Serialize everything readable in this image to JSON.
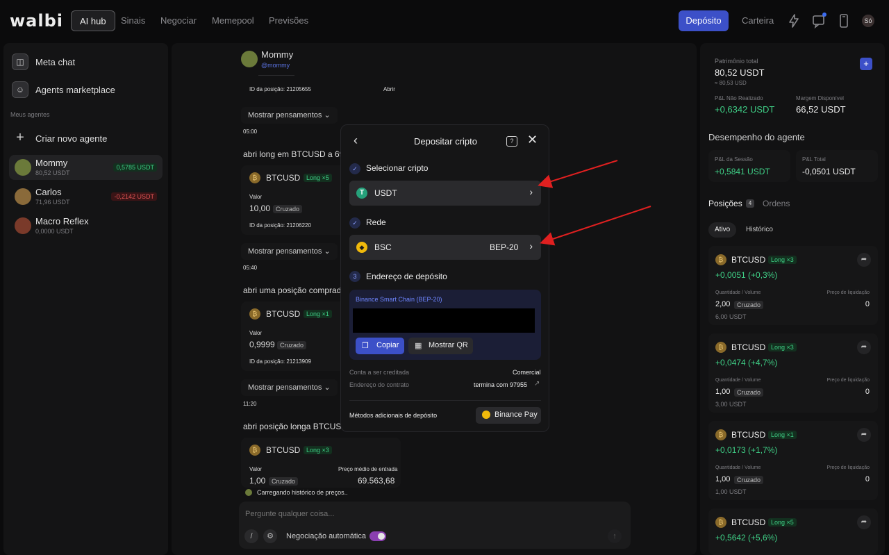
{
  "header": {
    "logo": "walbi",
    "nav": [
      "AI hub",
      "Sinais",
      "Negociar",
      "Memepool",
      "Previsões"
    ],
    "deposit_label": "Depósito",
    "wallet_label": "Carteira",
    "avatar": "Só"
  },
  "sidebar": {
    "meta_chat": "Meta chat",
    "agents_marketplace": "Agents marketplace",
    "section": "Meus agentes",
    "create": "Criar novo agente",
    "agents": [
      {
        "name": "Mommy",
        "balance": "80,52 USDT",
        "pnl": "0,5785 USDT"
      },
      {
        "name": "Carlos",
        "balance": "71,96 USDT",
        "pnl": "-0,2142 USDT"
      },
      {
        "name": "Macro Reflex",
        "balance": "0,0000 USDT",
        "pnl": ""
      }
    ]
  },
  "feed": {
    "agent_name": "Mommy",
    "agent_handle": "@mommy",
    "pos_id_1": "ID da posição: 21205655",
    "open_label": "Abrir",
    "show_thoughts": "Mostrar pensamentos",
    "time_1": "05:00",
    "msg_1": "abri long em BTCUSD a 6987",
    "pair": "BTCUSD",
    "card1_tag": "Long ×5",
    "value_label": "Valor",
    "card1_value": "10,00",
    "cross": "Cruzado",
    "pos_id_2": "ID da posição: 21206220",
    "time_2": "05:40",
    "msg_2": "abri uma posição comprada (E",
    "card2_tag": "Long ×1",
    "card2_value": "0,9999",
    "pos_id_3": "ID da posição: 21213909",
    "time_3": "11:20",
    "msg_3": "abri posição longa BTCUSD a",
    "card3_tag": "Long ×3",
    "card3_value": "1,00",
    "avg_price_label": "Preço médio de entrada",
    "avg_price": "69.563,68",
    "loading": "Carregando histórico de preços..",
    "chat_placeholder": "Pergunte qualquer coisa...",
    "auto_trading": "Negociação automática"
  },
  "modal": {
    "title": "Depositar cripto",
    "step1": "Selecionar cripto",
    "crypto": "USDT",
    "step2": "Rede",
    "network": "BSC",
    "network_std": "BEP-20",
    "step3_num": "3",
    "step3": "Endereço de depósito",
    "chain": "Binance Smart Chain (BEP-20)",
    "copy": "Copiar",
    "show_qr": "Mostrar QR",
    "account_label": "Conta a ser creditada",
    "account_value": "Comercial",
    "contract_label": "Endereço do contrato",
    "contract_value": "termina com 97955",
    "extra_methods": "Métodos adicionais de depósito",
    "binance_pay": "Binance Pay"
  },
  "right": {
    "equity_label": "Patrimônio total",
    "equity": "80,52 USDT",
    "equity_sub": "≈ 80,53 USD",
    "unrealized_label": "P&L Não Realizado",
    "unrealized": "+0,6342 USDT",
    "margin_label": "Margem Disponível",
    "margin": "66,52 USDT",
    "perf_title": "Desempenho do agente",
    "session_label": "P&L da Sessão",
    "session": "+0,5841 USDT",
    "total_label": "P&L Total",
    "total": "-0,0501 USDT",
    "tab_positions": "Posições",
    "positions_count": "4",
    "tab_orders": "Ordens",
    "sub_active": "Ativo",
    "sub_history": "Histórico",
    "qty_label": "Quantidade / Volume",
    "liq_label": "Preço de liquidação",
    "positions": [
      {
        "pair": "BTCUSD",
        "tag": "Long ×3",
        "pnl": "+0,0051 (+0,3%)",
        "qty": "2,00",
        "vol": "6,00 USDT",
        "liq": "0"
      },
      {
        "pair": "BTCUSD",
        "tag": "Long ×3",
        "pnl": "+0,0474 (+4,7%)",
        "qty": "1,00",
        "vol": "3,00 USDT",
        "liq": "0"
      },
      {
        "pair": "BTCUSD",
        "tag": "Long ×1",
        "pnl": "+0,0173 (+1,7%)",
        "qty": "1,00",
        "vol": "1,00 USDT",
        "liq": "0"
      },
      {
        "pair": "BTCUSD",
        "tag": "Long ×5",
        "pnl": "+0,5642 (+5,6%)",
        "qty": "",
        "vol": "",
        "liq": ""
      }
    ]
  },
  "colors": {
    "accent": "#3c50c8",
    "positive": "#3fcf86",
    "negative": "#e05555",
    "annotation_arrow": "#e02020"
  }
}
